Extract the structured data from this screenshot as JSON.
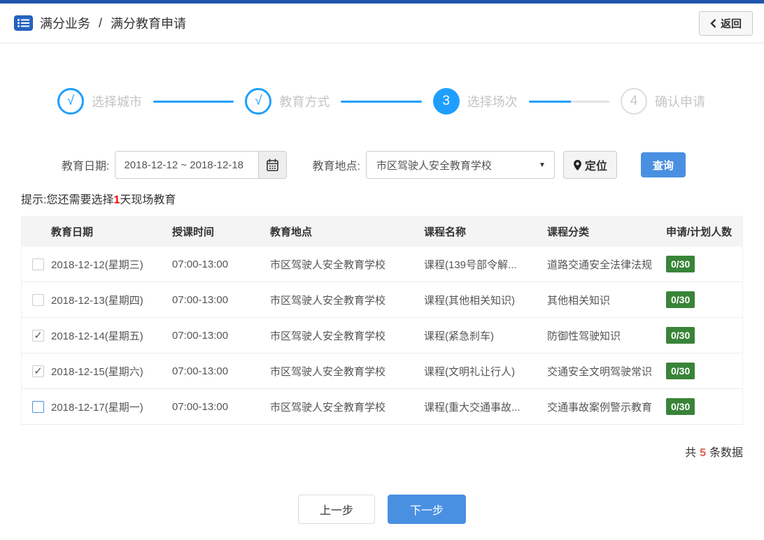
{
  "colors": {
    "top-bar": "#1e56ad",
    "step-blue": "#1e9fff",
    "button-blue": "#4a90e2",
    "badge-green": "#398439",
    "hint-red": "#ff0000",
    "count-red": "#e25b50"
  },
  "header": {
    "breadcrumb_section": "满分业务",
    "breadcrumb_separator": "/",
    "breadcrumb_page": "满分教育申请",
    "back_label": "返回"
  },
  "stepper": {
    "steps": [
      {
        "indicator": "√",
        "label": "选择城市",
        "state": "done"
      },
      {
        "indicator": "√",
        "label": "教育方式",
        "state": "done"
      },
      {
        "indicator": "3",
        "label": "选择场次",
        "state": "current"
      },
      {
        "indicator": "4",
        "label": "确认申请",
        "state": "pending"
      }
    ]
  },
  "filters": {
    "date_label": "教育日期:",
    "date_value": "2018-12-12 ~ 2018-12-18",
    "location_label": "教育地点:",
    "location_value": "市区驾驶人安全教育学校",
    "select_arrow": "▼",
    "locate_label": "定位",
    "search_label": "查询"
  },
  "hint": {
    "prefix": "提示:您还需要选择",
    "highlight": "1",
    "suffix": "天现场教育"
  },
  "table": {
    "columns": [
      "教育日期",
      "授课时间",
      "教育地点",
      "课程名称",
      "课程分类",
      "申请/计划人数"
    ],
    "rows": [
      {
        "checkbox": "unchecked",
        "date": "2018-12-12(星期三)",
        "time": "07:00-13:00",
        "location": "市区驾驶人安全教育学校",
        "course": "课程(139号部令解...",
        "category": "道路交通安全法律法规",
        "quota": "0/30"
      },
      {
        "checkbox": "unchecked",
        "date": "2018-12-13(星期四)",
        "time": "07:00-13:00",
        "location": "市区驾驶人安全教育学校",
        "course": "课程(其他相关知识)",
        "category": "其他相关知识",
        "quota": "0/30"
      },
      {
        "checkbox": "checked",
        "date": "2018-12-14(星期五)",
        "time": "07:00-13:00",
        "location": "市区驾驶人安全教育学校",
        "course": "课程(紧急刹车)",
        "category": "防御性驾驶知识",
        "quota": "0/30"
      },
      {
        "checkbox": "checked",
        "date": "2018-12-15(星期六)",
        "time": "07:00-13:00",
        "location": "市区驾驶人安全教育学校",
        "course": "课程(文明礼让行人)",
        "category": "交通安全文明驾驶常识",
        "quota": "0/30"
      },
      {
        "checkbox": "unchecked-active",
        "date": "2018-12-17(星期一)",
        "time": "07:00-13:00",
        "location": "市区驾驶人安全教育学校",
        "course": "课程(重大交通事故...",
        "category": "交通事故案例警示教育",
        "quota": "0/30"
      }
    ],
    "check_glyph": "✓"
  },
  "summary": {
    "prefix": "共",
    "count": "5",
    "suffix": "条数据"
  },
  "footer": {
    "prev_label": "上一步",
    "next_label": "下一步"
  }
}
